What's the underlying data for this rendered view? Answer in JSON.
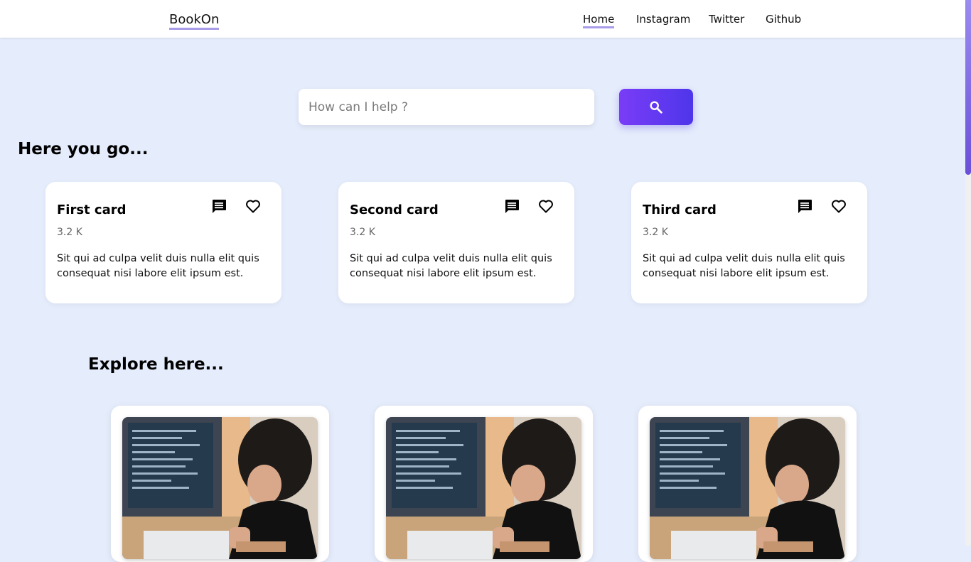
{
  "navbar": {
    "brand": "BookOn",
    "links": [
      {
        "label": "Home",
        "active": true
      },
      {
        "label": "Instagram",
        "active": false
      },
      {
        "label": "Twitter",
        "active": false
      },
      {
        "label": "Github",
        "active": false
      }
    ]
  },
  "search": {
    "placeholder": "How can I help ?",
    "value": "",
    "button_icon": "search-icon"
  },
  "sections": {
    "featured_title": "Here you go...",
    "explore_title": "Explore here..."
  },
  "cards": [
    {
      "title": "First card",
      "count": "3.2 K",
      "text": "Sit qui ad culpa velit duis nulla elit quis consequat nisi labore elit ipsum est.",
      "icons": [
        "comment-icon",
        "heart-icon"
      ]
    },
    {
      "title": "Second card",
      "count": "3.2 K",
      "text": "Sit qui ad culpa velit duis nulla elit quis consequat nisi labore elit ipsum est.",
      "icons": [
        "comment-icon",
        "heart-icon"
      ]
    },
    {
      "title": "Third card",
      "count": "3.2 K",
      "text": "Sit qui ad culpa velit duis nulla elit quis consequat nisi labore elit ipsum est.",
      "icons": [
        "comment-icon",
        "heart-icon"
      ]
    }
  ],
  "explore_cards": [
    {
      "image": "photo-woman-at-computer"
    },
    {
      "image": "photo-woman-at-computer"
    },
    {
      "image": "photo-woman-at-computer"
    }
  ],
  "colors": {
    "background": "#e5ecfb",
    "accent_start": "#7a3cf7",
    "accent_end": "#4e36ea",
    "underline": "#a89be8"
  }
}
